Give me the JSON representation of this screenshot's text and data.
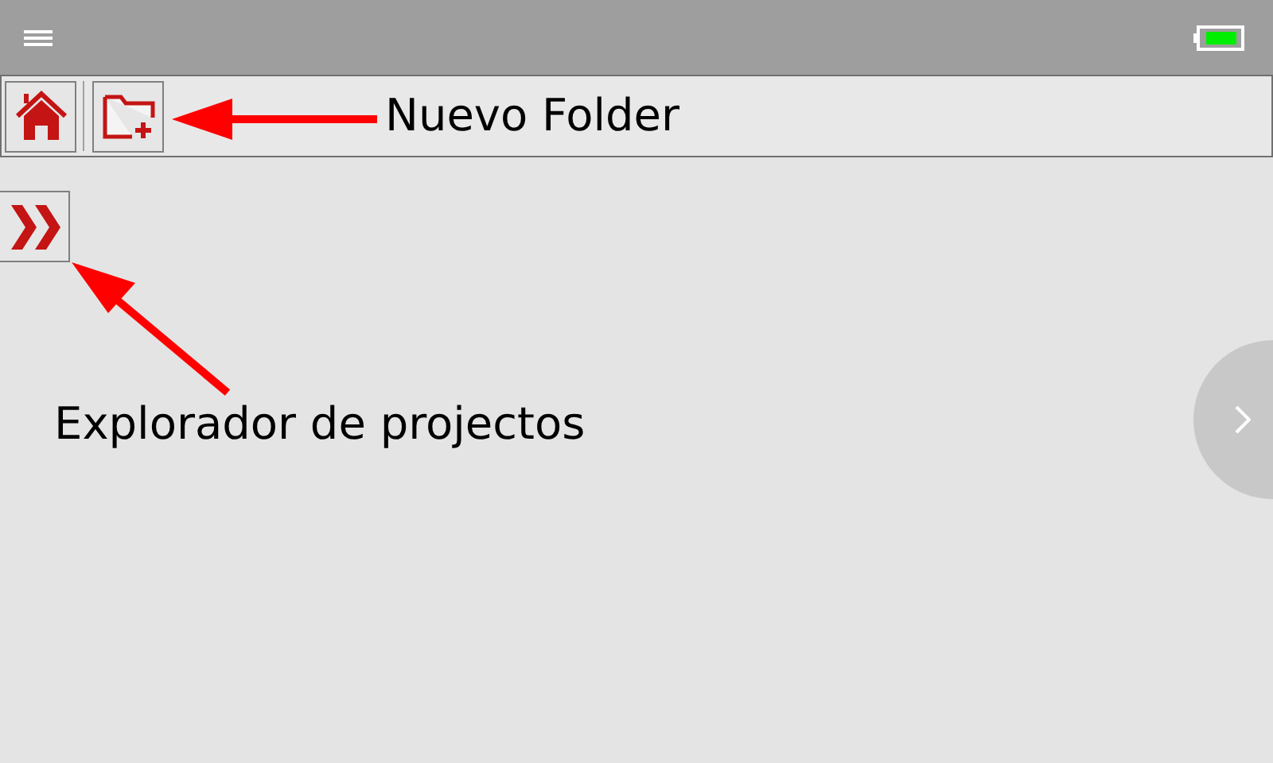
{
  "annotations": [
    {
      "text": "Nuevo Folder",
      "kind": "label-top"
    },
    {
      "text": "Explorador de projectos",
      "kind": "label-bottom"
    }
  ]
}
